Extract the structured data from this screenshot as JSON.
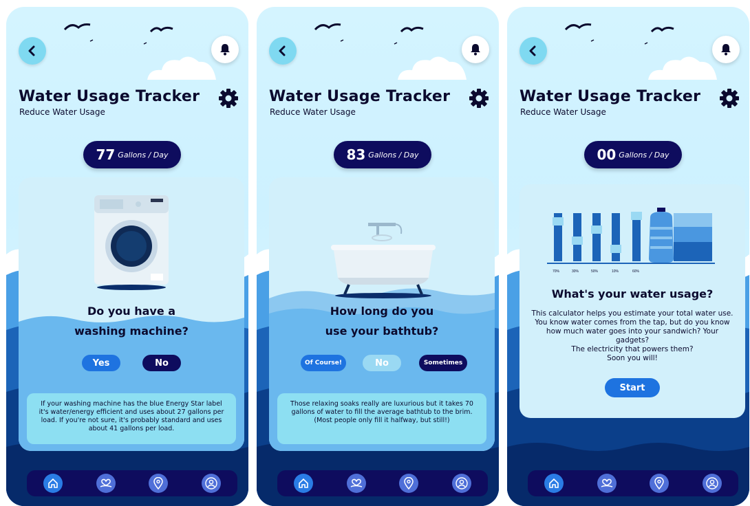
{
  "colors": {
    "accent": "#1e73e0",
    "dark": "#0e0c5e",
    "sky": "#d4f4ff",
    "sea_dark": "#0b3f8a",
    "sea_mid": "#1c64b8"
  },
  "icons": {
    "back": "chevron-left-icon",
    "bell": "bell-icon",
    "gear": "gear-icon",
    "nav": [
      "home-icon",
      "heart-hand-icon",
      "location-pin-icon",
      "user-icon"
    ]
  },
  "screens": [
    {
      "title": "Water Usage Tracker",
      "subtitle": "Reduce Water Usage",
      "gallons": "77",
      "unit": "Gallons / Day",
      "question_line1": "Do you have a",
      "question_line2": "washing machine?",
      "buttons": [
        "Yes",
        "No"
      ],
      "info": "If your washing machine has the blue Energy Star label it's water/energy efficient and uses about 27 gallons per load. If you're not sure, it's probably standard and uses about 41 gallons per load."
    },
    {
      "title": "Water Usage Tracker",
      "subtitle": "Reduce Water Usage",
      "gallons": "83",
      "unit": "Gallons / Day",
      "question_line1": "How long do you",
      "question_line2": "use your bathtub?",
      "buttons": [
        "Of Course!",
        "No",
        "Sometimes"
      ],
      "info": "Those relaxing soaks really are luxurious but it takes 70 gallons of water to fill the average bathtub to the brim. (Most people only fill it halfway, but still!)"
    },
    {
      "title": "Water Usage Tracker",
      "subtitle": "Reduce Water Usage",
      "gallons": "00",
      "unit": "Gallons / Day",
      "heading": "What's your water usage?",
      "desc": [
        "This calculator helps you estimate your total water use. You know water comes from the tap, but do you know how much water goes into your sandwich? Your gadgets?",
        "The electricity that powers them?",
        "Soon you will!"
      ],
      "chart_labels": [
        "70%",
        "30%",
        "50%",
        "10%",
        "60%"
      ],
      "start_label": "Start"
    }
  ]
}
